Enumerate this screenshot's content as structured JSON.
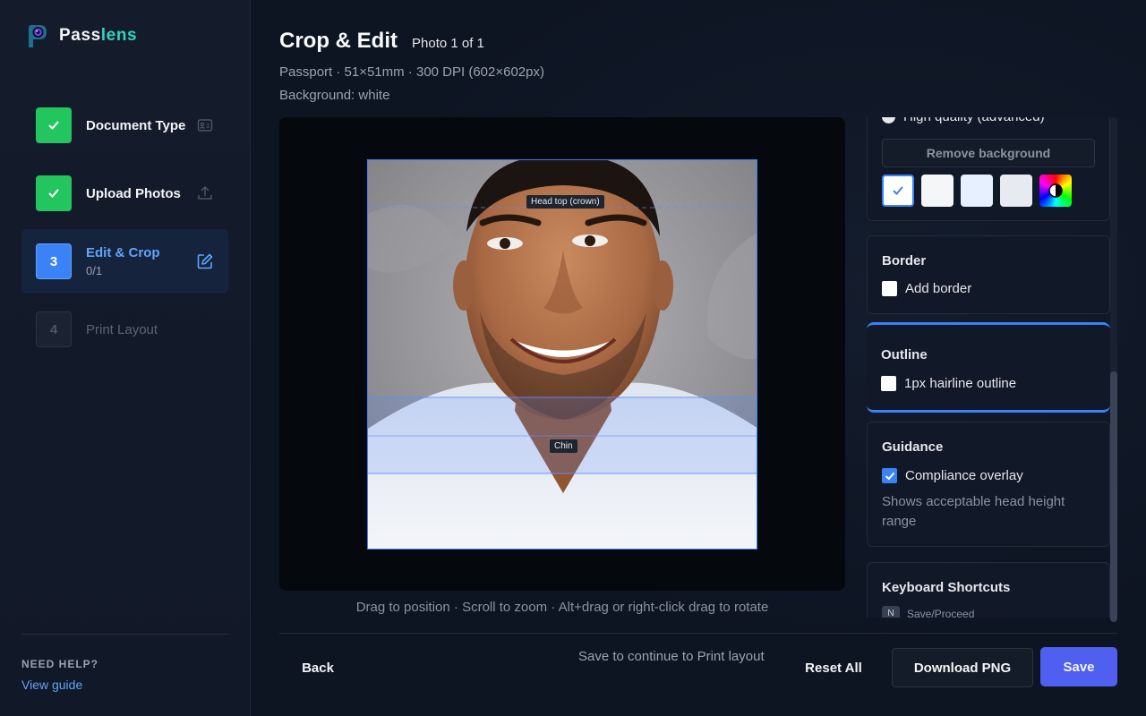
{
  "app": {
    "name_part1": "Pass",
    "name_part2": "lens"
  },
  "steps": [
    {
      "label": "Document Type",
      "sub": "",
      "state": "done"
    },
    {
      "label": "Upload Photos",
      "sub": "",
      "state": "done"
    },
    {
      "label": "Edit & Crop",
      "sub": "0/1",
      "number": "3",
      "state": "current"
    },
    {
      "label": "Print Layout",
      "sub": "",
      "number": "4",
      "state": "pending"
    }
  ],
  "help": {
    "title": "NEED HELP?",
    "link": "View guide"
  },
  "header": {
    "title": "Crop & Edit",
    "photo_count": "Photo 1 of 1",
    "spec": "Passport · 51×51mm · 300 DPI (602×602px)",
    "background": "Background: white"
  },
  "overlay": {
    "head_top_label": "Head top (crown)",
    "chin_label": "Chin"
  },
  "hint": "Drag to position · Scroll to zoom · Alt+drag or right-click drag to rotate",
  "panel": {
    "quality_option": "High quality (advanced)",
    "remove_bg_button": "Remove background",
    "swatch_colors": [
      "#ffffff",
      "#f5f6f8",
      "#e6f0ff",
      "#e7eaf0"
    ],
    "border": {
      "title": "Border",
      "option": "Add border",
      "checked": false
    },
    "outline": {
      "title": "Outline",
      "option": "1px hairline outline",
      "checked": false
    },
    "guidance": {
      "title": "Guidance",
      "option": "Compliance overlay",
      "checked": true,
      "description": "Shows acceptable head height range"
    },
    "shortcuts": {
      "title": "Keyboard Shortcuts",
      "items": [
        {
          "key": "N",
          "action": "Save/Proceed"
        }
      ]
    }
  },
  "footer": {
    "back": "Back",
    "status": "Save to continue to Print layout",
    "reset": "Reset All",
    "download": "Download PNG",
    "save": "Save"
  },
  "colors": {
    "accent": "#3b82f6",
    "success": "#22c55e",
    "teal": "#2dd4bf",
    "save": "#4f5ff0"
  }
}
